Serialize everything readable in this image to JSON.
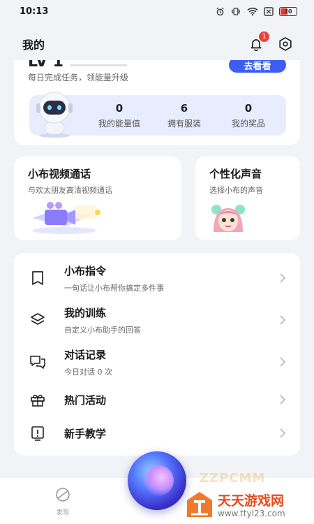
{
  "status_bar": {
    "time": "10:13",
    "battery": "20"
  },
  "header": {
    "title": "我的",
    "notification_count": "1"
  },
  "profile": {
    "level_label": "LV 1",
    "go_button_label": "去看看",
    "task_subtitle": "每日完成任务，领能量升级",
    "stats": [
      {
        "value": "0",
        "label": "我的能量值"
      },
      {
        "value": "6",
        "label": "拥有服装"
      },
      {
        "value": "0",
        "label": "我的奖品"
      }
    ]
  },
  "features": {
    "video_call": {
      "title": "小布视频通话",
      "subtitle": "与欢太朋友高清视频通话"
    },
    "voice": {
      "title": "个性化声音",
      "subtitle": "选择小布的声音"
    }
  },
  "menu": [
    {
      "icon": "bookmark-icon",
      "title": "小布指令",
      "subtitle": "一句话让小布帮你搞定多件事"
    },
    {
      "icon": "layers-icon",
      "title": "我的训练",
      "subtitle": "自定义小布助手的回答"
    },
    {
      "icon": "chat-icon",
      "title": "对话记录",
      "subtitle": "今日对话 0 次"
    },
    {
      "icon": "gift-icon",
      "title": "热门活动",
      "subtitle": ""
    },
    {
      "icon": "tutorial-icon",
      "title": "新手教学",
      "subtitle": ""
    }
  ],
  "bottom_nav": {
    "discover_label": "发现"
  },
  "watermark": {
    "title": "天天游戏网",
    "url": "www.ttyl23.com",
    "faint": "ZZPCMM"
  },
  "colors": {
    "accent": "#3d5df5",
    "badge": "#e8423a",
    "stats_bg": "#e9ecff",
    "watermark": "#e64a1a"
  }
}
